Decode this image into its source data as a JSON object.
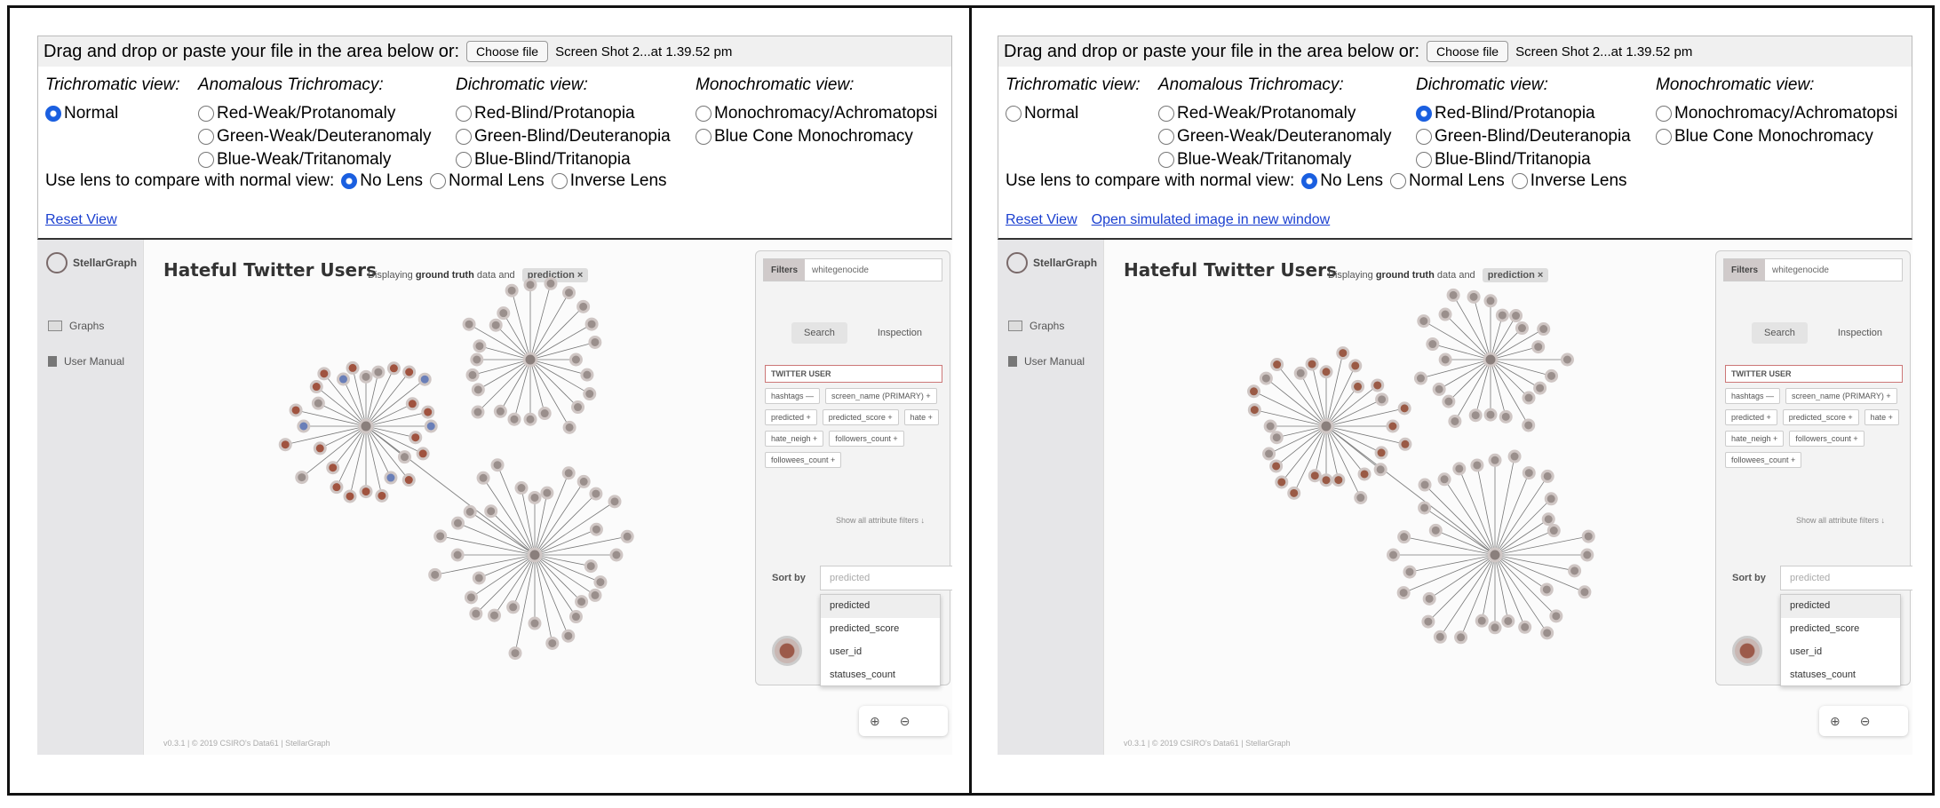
{
  "panels": [
    {
      "id": "left",
      "top_label": "Drag and drop or paste your file in the area below or:",
      "choose_label": "Choose file",
      "file_name": "Screen Shot 2...at 1.39.52 pm",
      "sections": [
        {
          "header": "Trichromatic view:",
          "options": [
            "Normal"
          ]
        },
        {
          "header": "Anomalous Trichromacy:",
          "options": [
            "Red-Weak/Protanomaly",
            "Green-Weak/Deuteranomaly",
            "Blue-Weak/Tritanomaly"
          ]
        },
        {
          "header": "Dichromatic view:",
          "options": [
            "Red-Blind/Protanopia",
            "Green-Blind/Deuteranopia",
            "Blue-Blind/Tritanopia"
          ]
        },
        {
          "header": "Monochromatic view:",
          "options": [
            "Monochromacy/Achromatopsi",
            "Blue Cone Monochromacy"
          ]
        }
      ],
      "selected": "Normal",
      "lens_label": "Use lens to compare with normal view:",
      "lens_options": [
        "No Lens",
        "Normal Lens",
        "Inverse Lens"
      ],
      "lens_selected": "No Lens",
      "reset_label": "Reset View",
      "open_label": ""
    },
    {
      "id": "right",
      "top_label": "Drag and drop or paste your file in the area below or:",
      "choose_label": "Choose file",
      "file_name": "Screen Shot 2...at 1.39.52 pm",
      "sections": [
        {
          "header": "Trichromatic view:",
          "options": [
            "Normal"
          ]
        },
        {
          "header": "Anomalous Trichromacy:",
          "options": [
            "Red-Weak/Protanomaly",
            "Green-Weak/Deuteranomaly",
            "Blue-Weak/Tritanomaly"
          ]
        },
        {
          "header": "Dichromatic view:",
          "options": [
            "Red-Blind/Protanopia",
            "Green-Blind/Deuteranopia",
            "Blue-Blind/Tritanopia"
          ]
        },
        {
          "header": "Monochromatic view:",
          "options": [
            "Monochromacy/Achromatopsi",
            "Blue Cone Monochromacy"
          ]
        }
      ],
      "selected": "Red-Blind/Protanopia",
      "lens_label": "Use lens to compare with normal view:",
      "lens_options": [
        "No Lens",
        "Normal Lens",
        "Inverse Lens"
      ],
      "lens_selected": "No Lens",
      "reset_label": "Reset View",
      "open_label": "Open simulated image in new window"
    }
  ],
  "app": {
    "brand": "StellarGraph",
    "nav": [
      "Graphs",
      "User Manual"
    ],
    "title": "Hateful Twitter Users",
    "displaying_prefix": "Displaying",
    "displaying_bold": "ground truth",
    "displaying_suffix": "data and",
    "chip": "prediction ×",
    "filters_label": "Filters",
    "filters_query": "whitegenocide",
    "tab_search": "Search",
    "tab_inspection": "Inspection",
    "twitter_user": "TWITTER USER",
    "attributes": [
      "hashtags —",
      "screen_name (PRIMARY) +",
      "predicted +",
      "predicted_score +",
      "hate +",
      "hate_neigh +",
      "followers_count +",
      "followees_count +"
    ],
    "show_all": "Show all attribute filters ↓",
    "sort_by": "Sort by",
    "sort_placeholder": "predicted",
    "sort_options": [
      "predicted",
      "predicted_score",
      "user_id",
      "statuses_count"
    ],
    "footer": "v0.3.1 | © 2019 CSIRO's Data61 | StellarGraph"
  },
  "colors": {
    "radio_selected": "#1a5fe0",
    "link": "#1a3fd0",
    "node_gray": "#9a8f8c",
    "node_brown_left": "#a0533f",
    "node_blue_left": "#6a7fb8",
    "node_brown_right": "#9a5a45"
  }
}
